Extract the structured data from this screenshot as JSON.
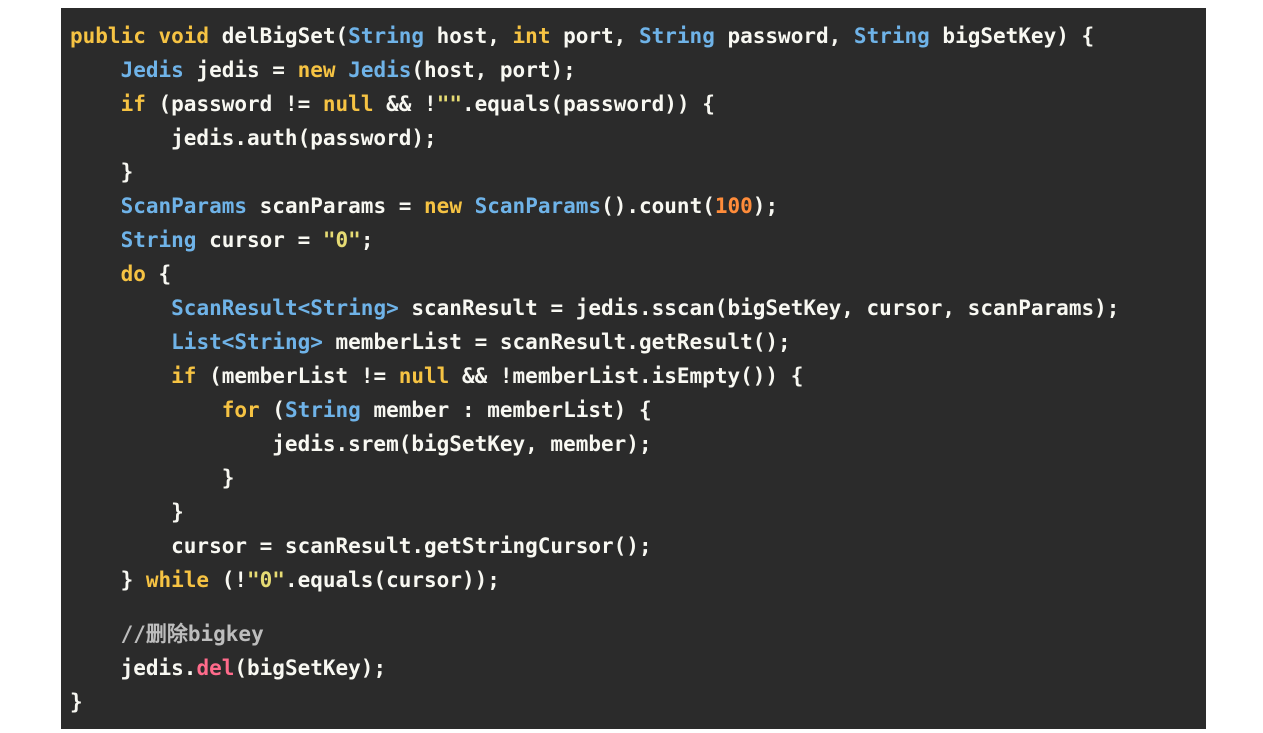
{
  "colors": {
    "background": "#2b2b2b",
    "page": "#ffffff",
    "plain": "#f8f8f2",
    "keyword": "#f6c343",
    "type": "#6fb3e8",
    "string": "#e6db74",
    "number": "#ff8c3a",
    "comment": "#bdbdbd",
    "method_del": "#ff6b8b"
  },
  "code": {
    "lines": [
      [
        {
          "t": "public void ",
          "c": "keyword"
        },
        {
          "t": "delBigSet(",
          "c": "plain"
        },
        {
          "t": "String",
          "c": "type"
        },
        {
          "t": " host, ",
          "c": "plain"
        },
        {
          "t": "int",
          "c": "keyword"
        },
        {
          "t": " port, ",
          "c": "plain"
        },
        {
          "t": "String",
          "c": "type"
        },
        {
          "t": " password, ",
          "c": "plain"
        },
        {
          "t": "String",
          "c": "type"
        },
        {
          "t": " bigSetKey) {",
          "c": "plain"
        }
      ],
      [
        {
          "t": "    ",
          "c": "plain"
        },
        {
          "t": "Jedis",
          "c": "type"
        },
        {
          "t": " jedis = ",
          "c": "plain"
        },
        {
          "t": "new",
          "c": "keyword"
        },
        {
          "t": " ",
          "c": "plain"
        },
        {
          "t": "Jedis",
          "c": "type"
        },
        {
          "t": "(host, port);",
          "c": "plain"
        }
      ],
      [
        {
          "t": "    ",
          "c": "plain"
        },
        {
          "t": "if",
          "c": "keyword"
        },
        {
          "t": " (password != ",
          "c": "plain"
        },
        {
          "t": "null",
          "c": "keyword"
        },
        {
          "t": " && !",
          "c": "plain"
        },
        {
          "t": "\"\"",
          "c": "string"
        },
        {
          "t": ".equals(password)) {",
          "c": "plain"
        }
      ],
      [
        {
          "t": "        jedis.auth(password);",
          "c": "plain"
        }
      ],
      [
        {
          "t": "    }",
          "c": "plain"
        }
      ],
      [
        {
          "t": "    ",
          "c": "plain"
        },
        {
          "t": "ScanParams",
          "c": "type"
        },
        {
          "t": " scanParams = ",
          "c": "plain"
        },
        {
          "t": "new",
          "c": "keyword"
        },
        {
          "t": " ",
          "c": "plain"
        },
        {
          "t": "ScanParams",
          "c": "type"
        },
        {
          "t": "().count(",
          "c": "plain"
        },
        {
          "t": "100",
          "c": "number"
        },
        {
          "t": ");",
          "c": "plain"
        }
      ],
      [
        {
          "t": "    ",
          "c": "plain"
        },
        {
          "t": "String",
          "c": "type"
        },
        {
          "t": " cursor = ",
          "c": "plain"
        },
        {
          "t": "\"0\"",
          "c": "string"
        },
        {
          "t": ";",
          "c": "plain"
        }
      ],
      [
        {
          "t": "    ",
          "c": "plain"
        },
        {
          "t": "do",
          "c": "keyword"
        },
        {
          "t": " {",
          "c": "plain"
        }
      ],
      [
        {
          "t": "        ",
          "c": "plain"
        },
        {
          "t": "ScanResult<String>",
          "c": "type"
        },
        {
          "t": " scanResult = jedis.sscan(bigSetKey, cursor, scanParams);",
          "c": "plain"
        }
      ],
      [
        {
          "t": "        ",
          "c": "plain"
        },
        {
          "t": "List<String>",
          "c": "type"
        },
        {
          "t": " memberList = scanResult.getResult();",
          "c": "plain"
        }
      ],
      [
        {
          "t": "        ",
          "c": "plain"
        },
        {
          "t": "if",
          "c": "keyword"
        },
        {
          "t": " (memberList != ",
          "c": "plain"
        },
        {
          "t": "null",
          "c": "keyword"
        },
        {
          "t": " && !memberList.isEmpty()) {",
          "c": "plain"
        }
      ],
      [
        {
          "t": "            ",
          "c": "plain"
        },
        {
          "t": "for",
          "c": "keyword"
        },
        {
          "t": " (",
          "c": "plain"
        },
        {
          "t": "String",
          "c": "type"
        },
        {
          "t": " member : memberList) {",
          "c": "plain"
        }
      ],
      [
        {
          "t": "                jedis.srem(bigSetKey, member);",
          "c": "plain"
        }
      ],
      [
        {
          "t": "            }",
          "c": "plain"
        }
      ],
      [
        {
          "t": "        }",
          "c": "plain"
        }
      ],
      [
        {
          "t": "        cursor = scanResult.getStringCursor();",
          "c": "plain"
        }
      ],
      [
        {
          "t": "    } ",
          "c": "plain"
        },
        {
          "t": "while",
          "c": "keyword"
        },
        {
          "t": " (!",
          "c": "plain"
        },
        {
          "t": "\"0\"",
          "c": "string"
        },
        {
          "t": ".equals(cursor));",
          "c": "plain"
        }
      ],
      [],
      [
        {
          "t": "    ",
          "c": "plain"
        },
        {
          "t": "//删除bigkey",
          "c": "comment"
        }
      ],
      [
        {
          "t": "    jedis.",
          "c": "plain"
        },
        {
          "t": "del",
          "c": "method_del"
        },
        {
          "t": "(bigSetKey);",
          "c": "plain"
        }
      ],
      [
        {
          "t": "}",
          "c": "plain"
        }
      ]
    ]
  }
}
